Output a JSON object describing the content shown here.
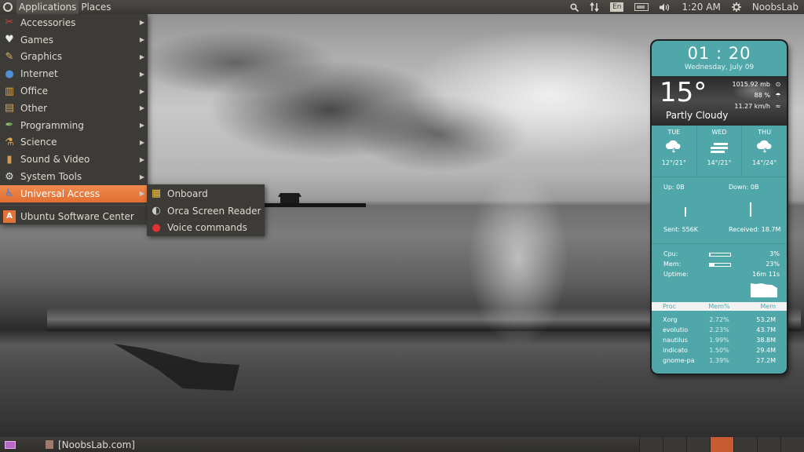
{
  "top_panel": {
    "menus": [
      {
        "label": "Applications",
        "active": true
      },
      {
        "label": "Places",
        "active": false
      }
    ],
    "tray": {
      "search_icon": "search-icon",
      "network_icon": "network-updown-icon",
      "keyboard_layout": "En",
      "battery_icon": "battery-icon",
      "volume_icon": "volume-icon",
      "clock": "1:20 AM",
      "settings_icon": "gear-icon",
      "user": "NoobsLab"
    }
  },
  "app_menu": {
    "items": [
      {
        "label": "Accessories",
        "icon": "accessories-icon",
        "glyph": "✂",
        "color": "#d8443a",
        "submenu": true
      },
      {
        "label": "Games",
        "icon": "games-icon",
        "glyph": "♥",
        "color": "#e8e8e8",
        "submenu": true
      },
      {
        "label": "Graphics",
        "icon": "graphics-icon",
        "glyph": "✎",
        "color": "#e0b46a",
        "submenu": true
      },
      {
        "label": "Internet",
        "icon": "internet-icon",
        "glyph": "●",
        "color": "#4f8fd6",
        "submenu": true
      },
      {
        "label": "Office",
        "icon": "office-icon",
        "glyph": "▥",
        "color": "#e2a33c",
        "submenu": true
      },
      {
        "label": "Other",
        "icon": "other-icon",
        "glyph": "▤",
        "color": "#c8a060",
        "submenu": true
      },
      {
        "label": "Programming",
        "icon": "programming-icon",
        "glyph": "✒",
        "color": "#8ac16a",
        "submenu": true
      },
      {
        "label": "Science",
        "icon": "science-icon",
        "glyph": "⚗",
        "color": "#d7a54a",
        "submenu": true
      },
      {
        "label": "Sound & Video",
        "icon": "sound-video-icon",
        "glyph": "▮",
        "color": "#d59a4d",
        "submenu": true
      },
      {
        "label": "System Tools",
        "icon": "system-tools-icon",
        "glyph": "⚙",
        "color": "#dedede",
        "submenu": true
      },
      {
        "label": "Universal Access",
        "icon": "universal-access-icon",
        "glyph": "♿",
        "color": "#3f7fd0",
        "submenu": true,
        "highlight": true
      }
    ],
    "footer_item": {
      "label": "Ubuntu Software Center",
      "icon": "software-center-icon",
      "glyph": "A",
      "color": "#e0723a"
    }
  },
  "submenu": {
    "items": [
      {
        "label": "Onboard",
        "icon": "onboard-icon",
        "glyph": "▦",
        "color": "#f0c040"
      },
      {
        "label": "Orca Screen Reader",
        "icon": "orca-icon",
        "glyph": "◐",
        "color": "#cccccc"
      },
      {
        "label": "Voice commands",
        "icon": "voice-commands-icon",
        "glyph": "●",
        "color": "#e03030"
      }
    ]
  },
  "widget": {
    "time": "01 : 20",
    "date": "Wednesday, July 09",
    "temperature": "15°",
    "condition": "Partly Cloudy",
    "pressure": "1015.92 mb",
    "humidity": "88 %",
    "wind": "11.27 km/h",
    "forecast": [
      {
        "day": "TUE",
        "icon": "thunderstorm-icon",
        "temps": "12°/21°"
      },
      {
        "day": "WED",
        "icon": "windy-icon",
        "temps": "14°/21°"
      },
      {
        "day": "THU",
        "icon": "thunderstorm-icon",
        "temps": "14°/24°"
      }
    ],
    "network": {
      "up": "Up: 0B",
      "down": "Down: 0B",
      "sent": "Sent: 556K",
      "received": "Received: 18.7M"
    },
    "system": {
      "cpu_label": "Cpu:",
      "cpu_value": "3%",
      "cpu_fraction": 0.03,
      "mem_label": "Mem:",
      "mem_value": "23%",
      "mem_fraction": 0.23,
      "uptime_label": "Uptime:",
      "uptime_value": "16m 11s"
    },
    "process_headers": [
      "Proc",
      "Mem%",
      "Mem"
    ],
    "processes": [
      {
        "name": "Xorg",
        "mem_pct": "2.72%",
        "mem": "53.2M"
      },
      {
        "name": "evolutio",
        "mem_pct": "2.23%",
        "mem": "43.7M"
      },
      {
        "name": "nautilus",
        "mem_pct": "1.99%",
        "mem": "38.8M"
      },
      {
        "name": "indicato",
        "mem_pct": "1.50%",
        "mem": "29.4M"
      },
      {
        "name": "gnome-pa",
        "mem_pct": "1.39%",
        "mem": "27.2M"
      }
    ]
  },
  "bottom_panel": {
    "show_desktop_icon": "show-desktop-icon",
    "tasks": [
      {
        "label": "[NoobsLab.com]"
      }
    ],
    "workspaces": [
      false,
      false,
      false,
      true,
      false,
      false,
      false
    ]
  }
}
